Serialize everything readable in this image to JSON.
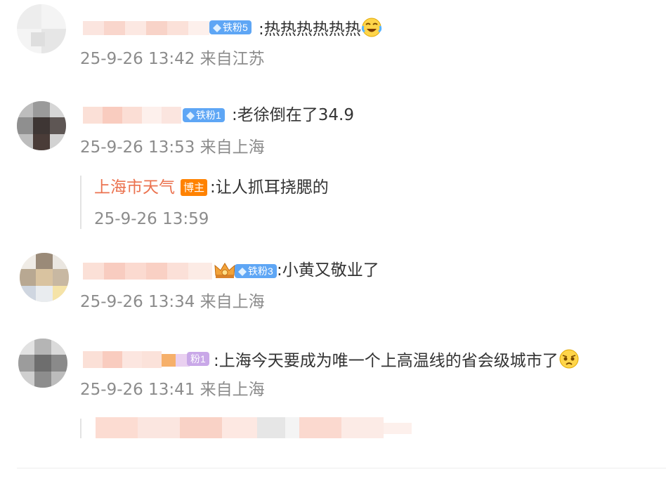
{
  "comments": [
    {
      "badge": "铁粉5",
      "text": ":热热热热热热",
      "emoji_icon": "laugh-cry-emoji",
      "time": "25-9-26 13:42",
      "location": "来自江苏"
    },
    {
      "badge": "铁粉1",
      "text": ":老徐倒在了34.9",
      "time": "25-9-26 13:53",
      "location": "来自上海",
      "reply": {
        "author": "上海市天气",
        "author_badge": "博主",
        "text": ":让人抓耳挠腮的",
        "time": "25-9-26 13:59"
      }
    },
    {
      "badge": "铁粉3",
      "crown_icon": "crown-icon",
      "text": ":小黄又敬业了",
      "time": "25-9-26 13:34",
      "location": "来自上海"
    },
    {
      "badge": "粉1",
      "text": ":上海今天要成为唯一个上高温线的省会级城市了",
      "emoji_icon": "pleading-emoji",
      "time": "25-9-26 13:41",
      "location": "来自上海"
    }
  ],
  "colors": {
    "badge_blue": "#5ea6f5",
    "author_orange": "#eb7350",
    "owner_badge": "#ff8200",
    "meta_gray": "#8c8c8c"
  }
}
